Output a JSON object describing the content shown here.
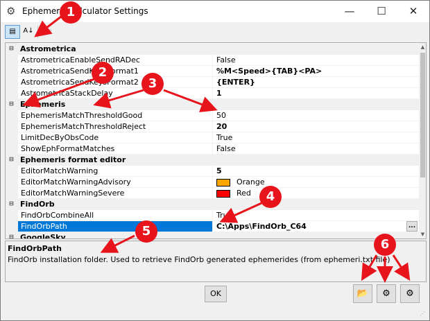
{
  "window": {
    "title": "Ephemeris Calculator Settings",
    "minimize_glyph": "—",
    "maximize_glyph": "☐",
    "close_glyph": "✕",
    "gear_glyph": "⚙"
  },
  "toolbar": {
    "categorized_glyph": "▤",
    "alphabetical_glyph": "A↓",
    "property_pages_glyph": "▭"
  },
  "grid": {
    "categories": [
      {
        "name": "Astrometrica",
        "toggle": "⊟",
        "props": [
          {
            "name": "AstrometricaEnableSendRADec",
            "value": "False",
            "bold": false
          },
          {
            "name": "AstrometricaSendKeysFormat1",
            "value": "%M<Speed>{TAB}<PA>",
            "bold": true
          },
          {
            "name": "AstrometricaSendKeysFormat2",
            "value": "{ENTER}",
            "bold": true
          },
          {
            "name": "AstrometricaStackDelay",
            "value": "1",
            "bold": true
          }
        ]
      },
      {
        "name": "Ephemeris",
        "toggle": "⊟",
        "props": [
          {
            "name": "EphemerisMatchThresholdGood",
            "value": "50",
            "bold": false
          },
          {
            "name": "EphemerisMatchThresholdReject",
            "value": "20",
            "bold": true
          },
          {
            "name": "LimitDecByObsCode",
            "value": "True",
            "bold": false
          },
          {
            "name": "ShowEphFormatMatches",
            "value": "False",
            "bold": false
          }
        ]
      },
      {
        "name": "Ephemeris format editor",
        "toggle": "⊟",
        "props": [
          {
            "name": "EditorMatchWarning",
            "value": "5",
            "bold": true
          },
          {
            "name": "EditorMatchWarningAdvisory",
            "value": "Orange",
            "bold": false,
            "swatch": "#ffa500"
          },
          {
            "name": "EditorMatchWarningSevere",
            "value": "Red",
            "bold": false,
            "swatch": "#ff0000"
          }
        ]
      },
      {
        "name": "FindOrb",
        "toggle": "⊟",
        "props": [
          {
            "name": "FindOrbCombineAll",
            "value": "True",
            "bold": false
          },
          {
            "name": "FindOrbPath",
            "value": "C:\\Apps\\FindOrb_C64",
            "bold": true,
            "selected": true
          }
        ]
      },
      {
        "name": "GoogleSky",
        "toggle": "⊟",
        "props": []
      }
    ],
    "ellipsis_label": "..."
  },
  "description": {
    "title": "FindOrbPath",
    "text": "FindOrb installation folder. Used to retrieve FindOrb generated ephemerides (from ephemeri.txt file)"
  },
  "buttons": {
    "ok_label": "OK",
    "open_folder_glyph": "📂",
    "import_settings_glyph": "⚙",
    "export_settings_glyph": "⚙"
  },
  "annotations": [
    "1",
    "2",
    "3",
    "4",
    "5",
    "6"
  ],
  "colors": {
    "annotation_red": "#e8141b",
    "selection_blue": "#0078d7"
  }
}
